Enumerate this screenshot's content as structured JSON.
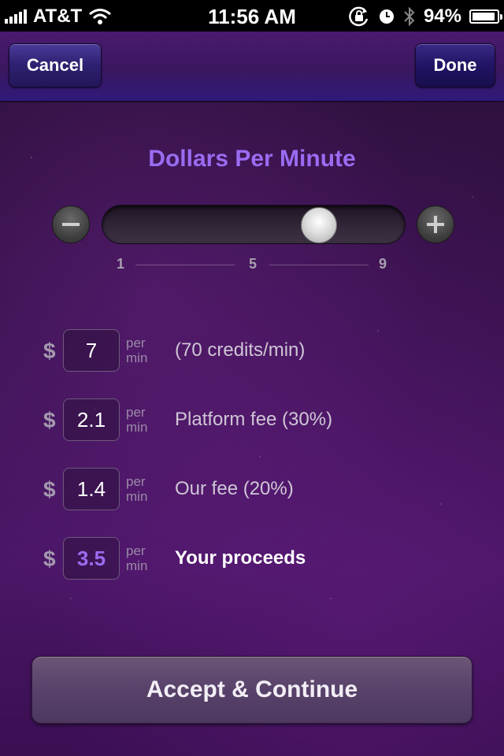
{
  "status_bar": {
    "carrier": "AT&T",
    "time": "11:56 AM",
    "battery_percent": "94%",
    "battery_level": 0.94,
    "icons": [
      "signal-icon",
      "wifi-icon",
      "rotation-lock-icon",
      "alarm-icon",
      "bluetooth-icon",
      "battery-icon"
    ]
  },
  "nav": {
    "cancel_label": "Cancel",
    "done_label": "Done"
  },
  "title": "Dollars Per Minute",
  "slider": {
    "min": 1,
    "max": 9,
    "value": 7,
    "ticks": [
      "1",
      "5",
      "9"
    ],
    "decrement_icon": "minus-icon",
    "increment_icon": "plus-icon"
  },
  "currency_symbol": "$",
  "rows": [
    {
      "value": "7",
      "unit_top": "per",
      "unit_bottom": "min",
      "description": "(70 credits/min)"
    },
    {
      "value": "2.1",
      "unit_top": "per",
      "unit_bottom": "min",
      "description": "Platform fee (30%)"
    },
    {
      "value": "1.4",
      "unit_top": "per",
      "unit_bottom": "min",
      "description": "Our fee (20%)"
    },
    {
      "value": "3.5",
      "unit_top": "per",
      "unit_bottom": "min",
      "description": "Your proceeds"
    }
  ],
  "accept_label": "Accept & Continue",
  "colors": {
    "accent": "#9a6cf2",
    "background": "#3a1250"
  }
}
